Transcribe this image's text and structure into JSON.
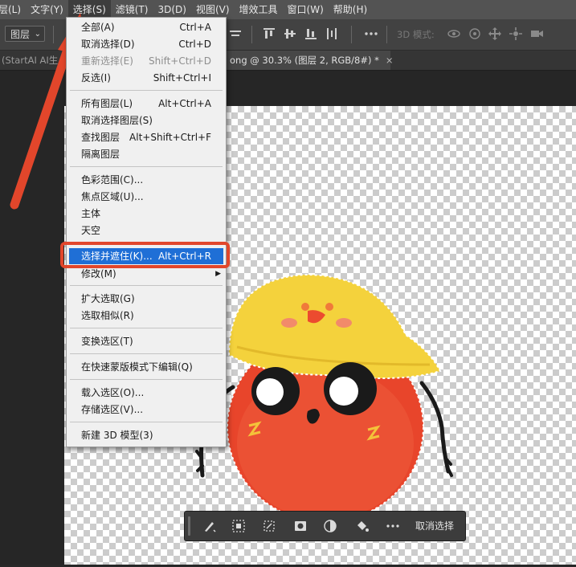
{
  "menubar": {
    "items": [
      "层(L)",
      "文字(Y)",
      "选择(S)",
      "滤镜(T)",
      "3D(D)",
      "视图(V)",
      "增效工具",
      "窗口(W)",
      "帮助(H)"
    ]
  },
  "options_bar": {
    "layer_select": "图层",
    "mode_3d_label": "3D 模式:"
  },
  "tabs": {
    "tab1": "(StartAI AI生",
    "tab2": "ong @ 30.3% (图层 2, RGB/8#) *",
    "close": "×"
  },
  "select_menu": {
    "items": [
      {
        "label": "全部(A)",
        "shortcut": "Ctrl+A"
      },
      {
        "label": "取消选择(D)",
        "shortcut": "Ctrl+D"
      },
      {
        "label": "重新选择(E)",
        "shortcut": "Shift+Ctrl+D"
      },
      {
        "label": "反选(I)",
        "shortcut": "Shift+Ctrl+I"
      },
      {
        "label": "所有图层(L)",
        "shortcut": "Alt+Ctrl+A"
      },
      {
        "label": "取消选择图层(S)",
        "shortcut": ""
      },
      {
        "label": "查找图层",
        "shortcut": "Alt+Shift+Ctrl+F"
      },
      {
        "label": "隔离图层",
        "shortcut": ""
      },
      {
        "label": "色彩范围(C)...",
        "shortcut": ""
      },
      {
        "label": "焦点区域(U)...",
        "shortcut": ""
      },
      {
        "label": "主体",
        "shortcut": ""
      },
      {
        "label": "天空",
        "shortcut": ""
      },
      {
        "label": "选择并遮住(K)...",
        "shortcut": "Alt+Ctrl+R"
      },
      {
        "label": "修改(M)",
        "shortcut": ""
      },
      {
        "label": "扩大选取(G)",
        "shortcut": ""
      },
      {
        "label": "选取相似(R)",
        "shortcut": ""
      },
      {
        "label": "变换选区(T)",
        "shortcut": ""
      },
      {
        "label": "在快速蒙版模式下编辑(Q)",
        "shortcut": ""
      },
      {
        "label": "载入选区(O)...",
        "shortcut": ""
      },
      {
        "label": "存储选区(V)...",
        "shortcut": ""
      },
      {
        "label": "新建 3D 模型(3)",
        "shortcut": ""
      }
    ]
  },
  "float_bar": {
    "deselect_label": "取消选择"
  },
  "colors": {
    "highlight": "#1f6fd6",
    "annotation": "#e2462b"
  }
}
